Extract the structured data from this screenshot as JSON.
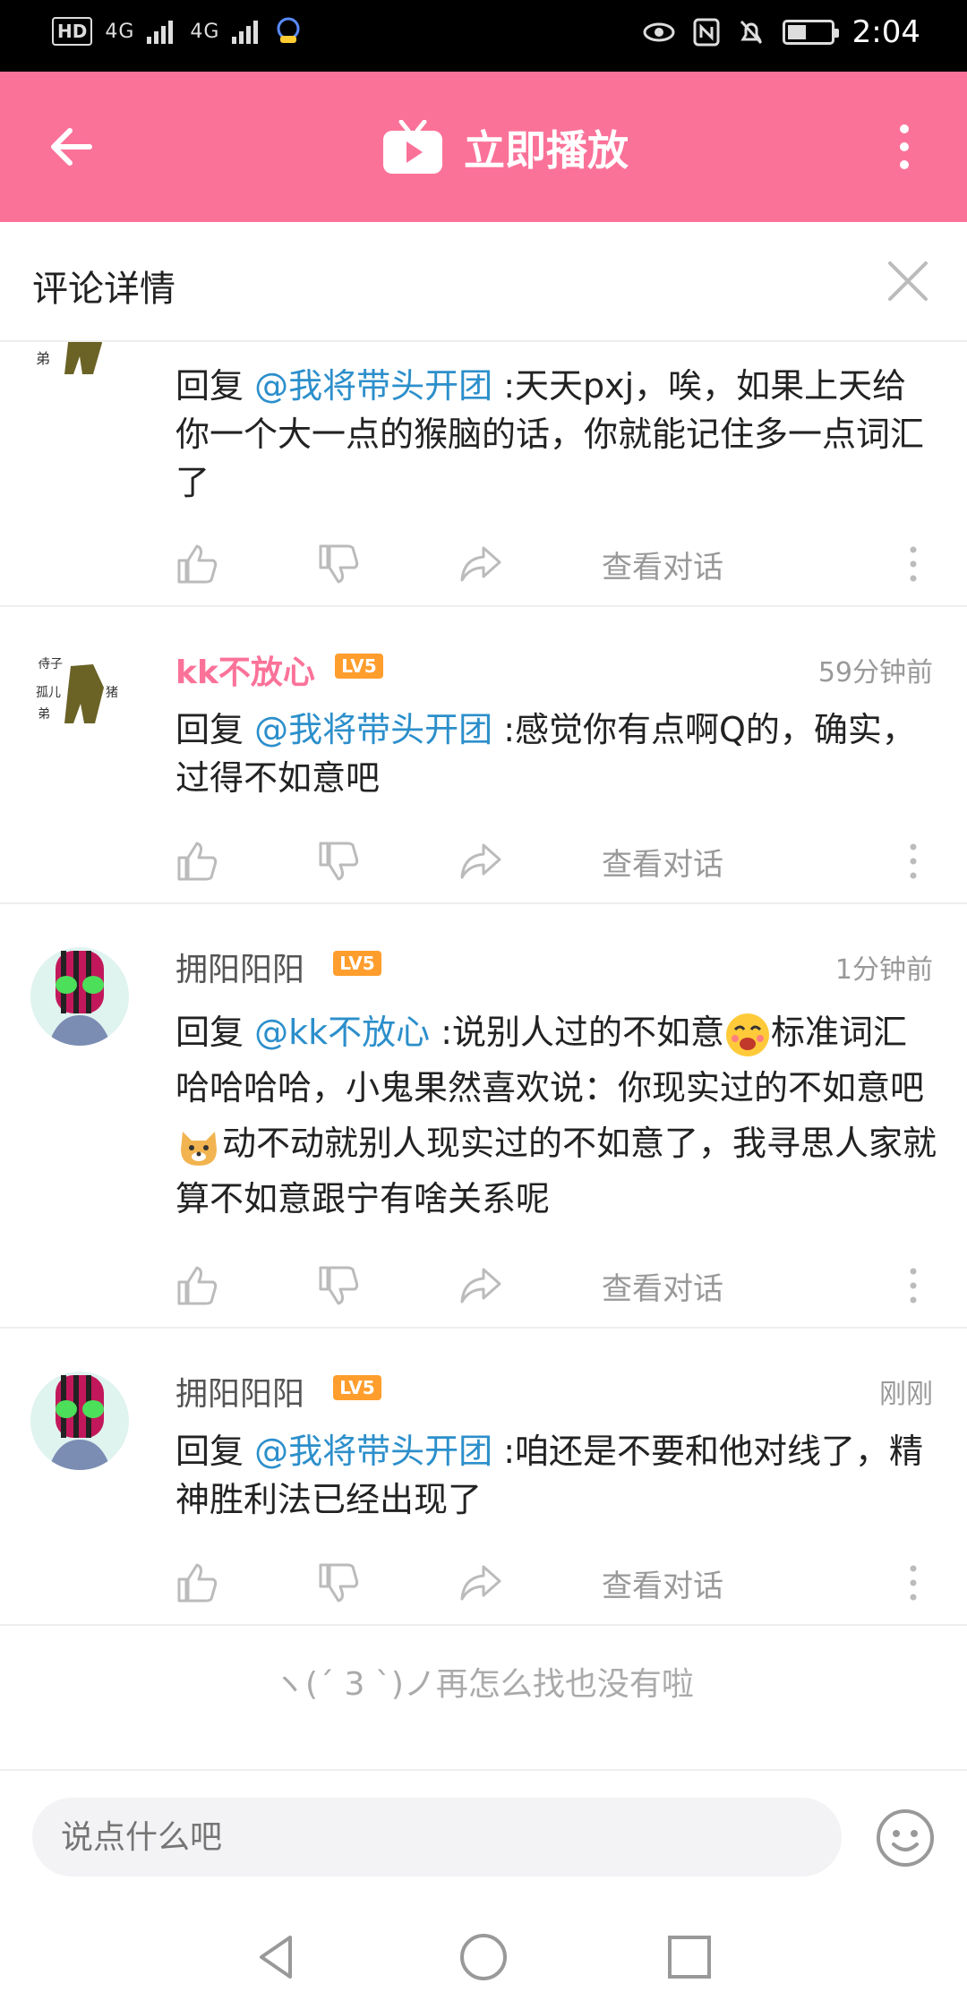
{
  "status_bar": {
    "left_chip_hd": "HD",
    "signal1": "4G",
    "signal2": "4G",
    "time": "2:04"
  },
  "app_bar": {
    "title": "立即播放",
    "back_icon": "back-arrow-icon",
    "menu_icon": "more-vert-icon"
  },
  "panel": {
    "title": "评论详情"
  },
  "comments": [
    {
      "username": "",
      "level": "",
      "time": "",
      "reply_prefix": "回复 ",
      "mention": "@我将带头开团",
      "text": " :天天pxj，唉，如果上天给你一个大一点的猴脑的话，你就能记住多一点词汇了",
      "view_label": "查看对话"
    },
    {
      "username": "kk不放心",
      "level": "LV5",
      "time": "59分钟前",
      "reply_prefix": "回复 ",
      "mention": "@我将带头开团",
      "text": " :感觉你有点啊Q的，确实，过得不如意吧",
      "view_label": "查看对话"
    },
    {
      "username": "拥阳阳阳",
      "level": "LV5",
      "time": "1分钟前",
      "reply_prefix": "回复 ",
      "mention": "@kk不放心",
      "text_a": " :说别人过的不如意",
      "text_b": "标准词汇哈哈哈哈，小鬼果然喜欢说：你现实过的不如意吧",
      "text_c": "动不动就别人现实过的不如意了，我寻思人家就算不如意跟宁有啥关系呢",
      "view_label": "查看对话"
    },
    {
      "username": "拥阳阳阳",
      "level": "LV5",
      "time": "刚刚",
      "reply_prefix": "回复 ",
      "mention": "@我将带头开团",
      "text": " :咱还是不要和他对线了，精神胜利法已经出现了",
      "view_label": "查看对话"
    }
  ],
  "end_note": "ヽ(ˊ 3 ˋ)ノ再怎么找也没有啦",
  "composer": {
    "placeholder": "说点什么吧"
  },
  "colors": {
    "brand_pink": "#fb7299",
    "mention_blue": "#2c8fcb",
    "level_orange": "#ff9d2d"
  }
}
